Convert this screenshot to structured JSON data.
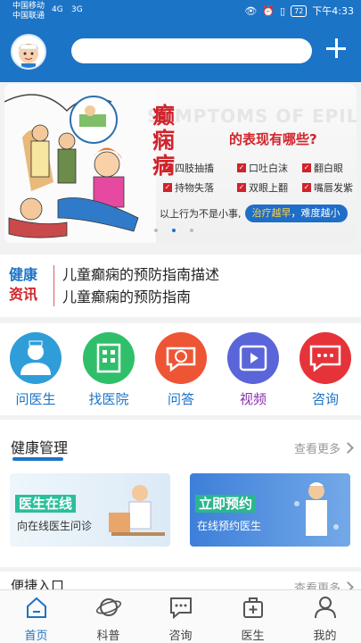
{
  "status_bar": {
    "carrier_1": "中国移动",
    "carrier_2": "中国联通",
    "signal_1": "4G",
    "signal_2": "3G",
    "battery": "72",
    "time": "下午4:33"
  },
  "header": {
    "search_placeholder": "",
    "add_icon": "plus-icon"
  },
  "banner": {
    "ghost_text": "SYMPTOMS OF EPILEPSY",
    "title": "癫痫病",
    "subtitle": "的表现有哪些?",
    "symptoms": [
      "四肢抽搐",
      "口吐白沫",
      "翻白眼",
      "持物失落",
      "双眼上翻",
      "嘴唇发紫"
    ],
    "footer_note": "以上行为不是小事,",
    "footer_pill_a": "治疗越早",
    "footer_pill_b": "，难度越小",
    "page_indicator": {
      "count": 3,
      "active": 1
    }
  },
  "news": {
    "logo_line1": "健康",
    "logo_line2": "资讯",
    "items": [
      "儿童癫痫的预防指南描述",
      "儿童癫痫的预防指南"
    ]
  },
  "quick_entries": [
    {
      "label": "问医生",
      "icon": "doctor-icon",
      "color": "#2f9ed8",
      "label_color": "#1c74c7"
    },
    {
      "label": "找医院",
      "icon": "hospital-icon",
      "color": "#2fbf6a",
      "label_color": "#1c74c7"
    },
    {
      "label": "问答",
      "icon": "question-chat-icon",
      "color": "#ee5535",
      "label_color": "#1c74c7"
    },
    {
      "label": "视频",
      "icon": "video-icon",
      "color": "#5965d8",
      "label_color": "#8a2fb0"
    },
    {
      "label": "咨询",
      "icon": "consult-chat-icon",
      "color": "#e6333a",
      "label_color": "#1c74c7"
    }
  ],
  "health_management": {
    "title": "健康管理",
    "more": "查看更多",
    "cards": [
      {
        "title": "医生在线",
        "subtitle": "向在线医生问诊"
      },
      {
        "title": "立即预约",
        "subtitle": "在线预约医生"
      }
    ]
  },
  "shortcut": {
    "title": "便捷入口",
    "more": "查看更多"
  },
  "bottom_nav": [
    {
      "label": "首页",
      "icon": "home-icon",
      "active": true
    },
    {
      "label": "科普",
      "icon": "planet-icon",
      "active": false
    },
    {
      "label": "咨询",
      "icon": "chat-icon",
      "active": false
    },
    {
      "label": "医生",
      "icon": "medical-bag-icon",
      "active": false
    },
    {
      "label": "我的",
      "icon": "user-icon",
      "active": false
    }
  ],
  "colors": {
    "primary": "#1c74c7",
    "accent_red": "#d0232b"
  }
}
